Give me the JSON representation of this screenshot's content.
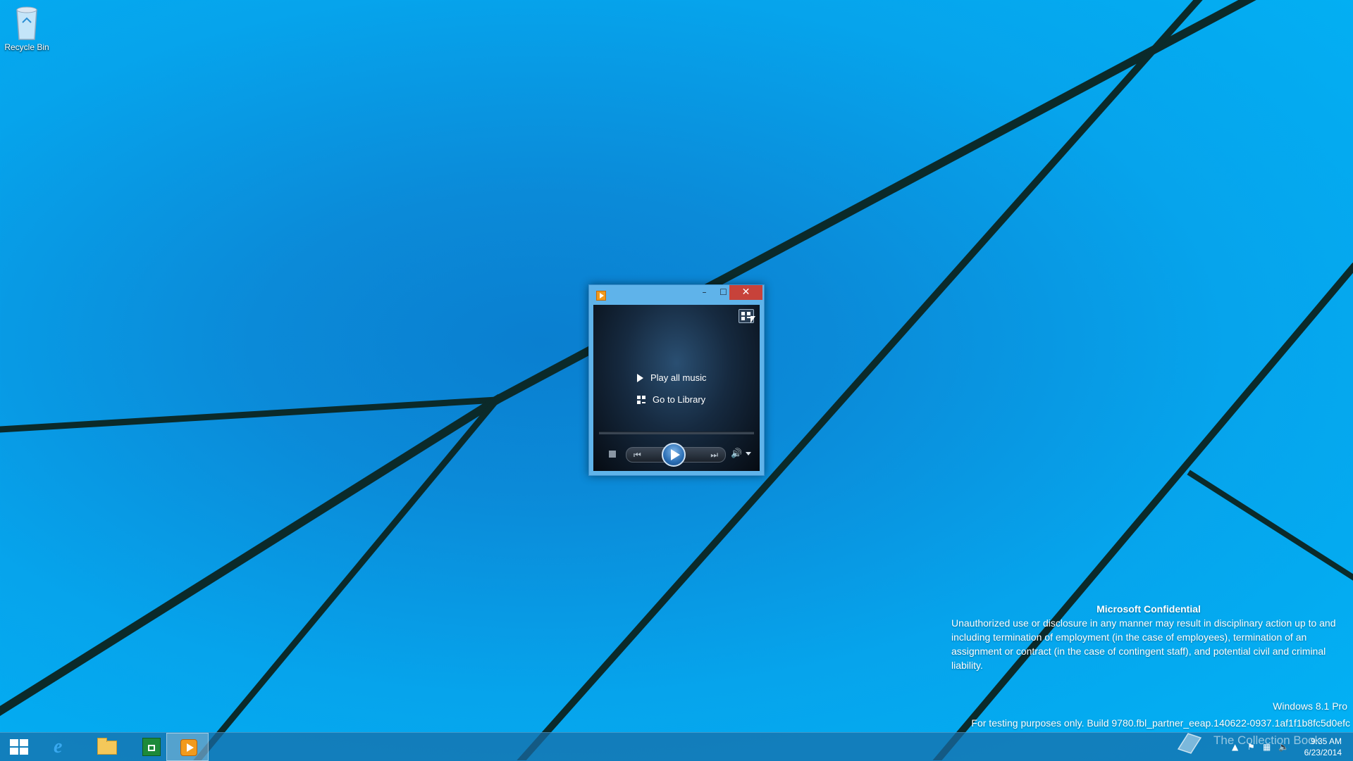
{
  "desktop": {
    "recycle_bin_label": "Recycle Bin"
  },
  "wmp": {
    "window_controls": {
      "minimize": "–",
      "maximize": "☐",
      "close": "✕"
    },
    "menu": {
      "play_all": "Play all music",
      "go_to_library": "Go to Library"
    },
    "icons": [
      "app-icon",
      "switch-to-library-icon",
      "stop-icon",
      "previous-icon",
      "play-icon",
      "next-icon",
      "volume-icon",
      "volume-dropdown-icon"
    ]
  },
  "notice": {
    "heading": "Microsoft Confidential",
    "body": "Unauthorized use or disclosure in any manner may result in disciplinary action up to and including termination of employment (in the case of employees), termination of an assignment or contract (in the case of contingent staff), and potential civil and criminal liability.",
    "edition": "Windows 8.1 Pro",
    "build": "For testing purposes only. Build 9780.fbl_partner_eeap.140622-0937.1af1f1b8fc5d0efc"
  },
  "taskbar": {
    "items": [
      "start-button",
      "internet-explorer",
      "file-explorer",
      "store",
      "windows-media-player"
    ],
    "active_item": "windows-media-player",
    "clock": {
      "time": "9:35 AM",
      "date": "6/23/2014"
    },
    "watermark": "The Collection Book"
  },
  "colors": {
    "desktop_bg": "#06a4ec",
    "window_frame": "#5fb3ea",
    "close_button": "#c7423a",
    "taskbar": "#186ea8"
  }
}
